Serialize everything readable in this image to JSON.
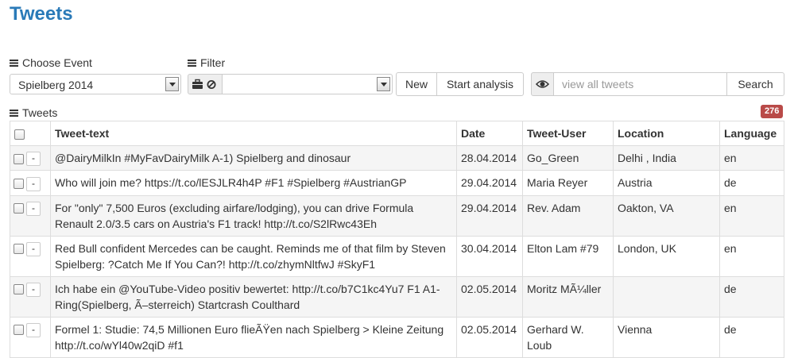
{
  "page": {
    "title": "Tweets"
  },
  "event_selector": {
    "label": "Choose Event",
    "selected": "Spielberg 2014"
  },
  "filter": {
    "label": "Filter",
    "selected": ""
  },
  "buttons": {
    "new": "New",
    "start_analysis": "Start analysis",
    "search": "Search"
  },
  "search": {
    "value": "",
    "placeholder": "view all tweets"
  },
  "tweets": {
    "label": "Tweets",
    "count": "276",
    "columns": [
      "Tweet-text",
      "Date",
      "Tweet-User",
      "Location",
      "Language"
    ],
    "rows": [
      {
        "text": "@DairyMilkIn #MyFavDairyMilk A-1) Spielberg and dinosaur",
        "date": "28.04.2014",
        "user": "Go_Green",
        "location": "Delhi , India",
        "lang": "en",
        "remove": "-"
      },
      {
        "text": "Who will join me? https://t.co/lESJLR4h4P #F1 #Spielberg #AustrianGP",
        "date": "29.04.2014",
        "user": "Maria Reyer",
        "location": "Austria",
        "lang": "de",
        "remove": "-"
      },
      {
        "text": "For \"only\" 7,500 Euros (excluding airfare/lodging), you can drive Formula Renault 2.0/3.5 cars on Austria's F1 track! http://t.co/S2lRwc43Eh",
        "date": "29.04.2014",
        "user": "Rev. Adam",
        "location": "Oakton, VA",
        "lang": "en",
        "remove": "-"
      },
      {
        "text": "Red Bull confident Mercedes can be caught. Reminds me of that film by Steven Spielberg: ?Catch Me If You Can?! http://t.co/zhymNltfwJ #SkyF1",
        "date": "30.04.2014",
        "user": "Elton Lam #79",
        "location": "London, UK",
        "lang": "en",
        "remove": "-"
      },
      {
        "text": "Ich habe ein @YouTube-Video positiv bewertet: http://t.co/b7C1kc4Yu7 F1 A1-Ring(Spielberg, Ã–sterreich) Startcrash Coulthard",
        "date": "02.05.2014",
        "user": "Moritz MÃ¼ller",
        "location": "",
        "lang": "de",
        "remove": "-"
      },
      {
        "text": "Formel 1: Studie: 74,5 Millionen Euro flieÃŸen nach Spielberg > Kleine Zeitung http://t.co/wYl40w2qiD #f1",
        "date": "02.05.2014",
        "user": "Gerhard W. Loub",
        "location": "Vienna",
        "lang": "de",
        "remove": "-"
      }
    ]
  }
}
